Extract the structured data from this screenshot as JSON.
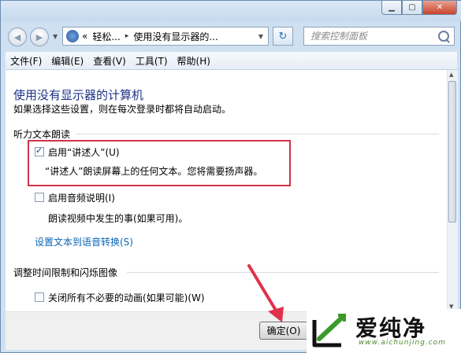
{
  "window": {
    "controls": {
      "minimize": "▁",
      "maximize": "▢",
      "close": "✕"
    }
  },
  "nav": {
    "back_glyph": "◀",
    "forward_glyph": "▶",
    "dropdown_glyph": "▼",
    "breadcrumb": [
      "«",
      "轻松...",
      "▸",
      "使用没有显示器的..."
    ],
    "search_placeholder": "搜索控制面板",
    "refresh_glyph": "↻"
  },
  "menu": [
    "文件(F)",
    "编辑(E)",
    "查看(V)",
    "工具(T)",
    "帮助(H)"
  ],
  "page": {
    "title": "使用没有显示器的计算机",
    "subtitle": "如果选择这些设置，则在每次登录时都将自动启动。",
    "section1": {
      "heading": "听力文本朗读",
      "narrator": {
        "label": "启用“讲述人”(U)",
        "checked": true,
        "desc": "“讲述人”朗读屏幕上的任何文本。您将需要扬声器。"
      },
      "audio_desc": {
        "label": "启用音频说明(I)",
        "checked": false,
        "desc": "朗读视频中发生的事(如果可用)。"
      },
      "link": "设置文本到语音转换(S)"
    },
    "section2": {
      "heading": "调整时间限制和闪烁图像",
      "animations": {
        "label": "关闭所有不必要的动画(如果可能)(W)",
        "checked": false
      }
    }
  },
  "footer": {
    "ok_label": "确定(O)"
  },
  "watermark": {
    "brand": "爱纯净",
    "url": "www.aichunjing.com"
  },
  "colors": {
    "title": "#1e3287",
    "link": "#0a66b6",
    "highlight": "#d2324a",
    "arrow": "#e0324b"
  }
}
